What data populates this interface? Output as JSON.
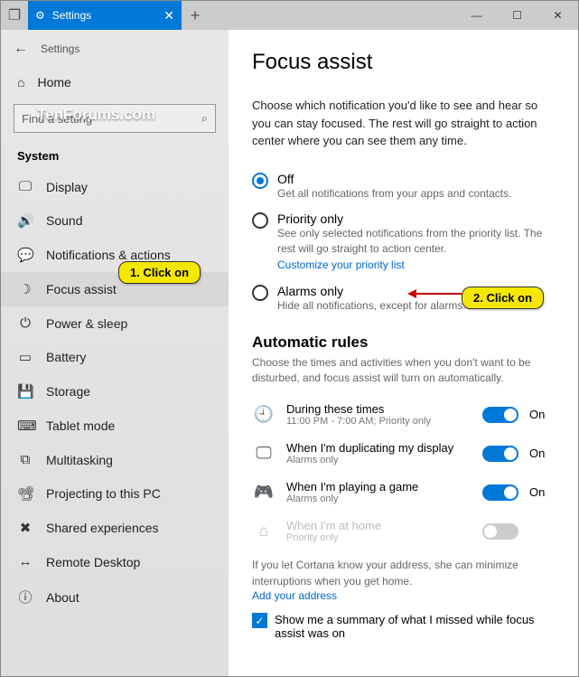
{
  "titlebar": {
    "tab_label": "Settings",
    "minimize": "—",
    "maximize": "☐",
    "close": "✕",
    "newtab": "+"
  },
  "sidebar": {
    "back_label": "Settings",
    "watermark": "TenForums.com",
    "home": "Home",
    "search_placeholder": "Find a setting",
    "category": "System",
    "items": [
      {
        "icon": "🖵",
        "label": "Display"
      },
      {
        "icon": "🔊",
        "label": "Sound"
      },
      {
        "icon": "💬",
        "label": "Notifications & actions"
      },
      {
        "icon": "☽",
        "label": "Focus assist"
      },
      {
        "icon": "⏻",
        "label": "Power & sleep"
      },
      {
        "icon": "▭",
        "label": "Battery"
      },
      {
        "icon": "💾",
        "label": "Storage"
      },
      {
        "icon": "⌨",
        "label": "Tablet mode"
      },
      {
        "icon": "⧉",
        "label": "Multitasking"
      },
      {
        "icon": "📽",
        "label": "Projecting to this PC"
      },
      {
        "icon": "✖",
        "label": "Shared experiences"
      },
      {
        "icon": "↔",
        "label": "Remote Desktop"
      },
      {
        "icon": "ⓘ",
        "label": "About"
      }
    ]
  },
  "main": {
    "title": "Focus assist",
    "desc": "Choose which notification you'd like to see and hear so you can stay focused. The rest will go straight to action center where you can see them any time.",
    "radios": {
      "off": {
        "label": "Off",
        "sub": "Get all notifications from your apps and contacts."
      },
      "priority": {
        "label": "Priority only",
        "sub": "See only selected notifications from the priority list. The rest will go straight to action center.",
        "link": "Customize your priority list"
      },
      "alarms": {
        "label": "Alarms only",
        "sub": "Hide all notifications, except for alarms."
      }
    },
    "rules_head": "Automatic rules",
    "rules_desc": "Choose the times and activities when you don't want to be disturbed, and focus assist will turn on automatically.",
    "rules": [
      {
        "icon": "🕘",
        "title": "During these times",
        "sub": "11:00 PM - 7:00 AM; Priority only",
        "on": "On"
      },
      {
        "icon": "🖵",
        "title": "When I'm duplicating my display",
        "sub": "Alarms only",
        "on": "On"
      },
      {
        "icon": "🎮",
        "title": "When I'm playing a game",
        "sub": "Alarms only",
        "on": "On"
      },
      {
        "icon": "⌂",
        "title": "When I'm at home",
        "sub": "Priority only",
        "on": ""
      }
    ],
    "foot": "If you let Cortana know your address, she can minimize interruptions when you get home.",
    "foot_link": "Add your address",
    "check": "Show me a summary of what I missed while focus assist was on"
  },
  "callouts": {
    "c1": "1. Click on",
    "c2": "2. Click on"
  }
}
